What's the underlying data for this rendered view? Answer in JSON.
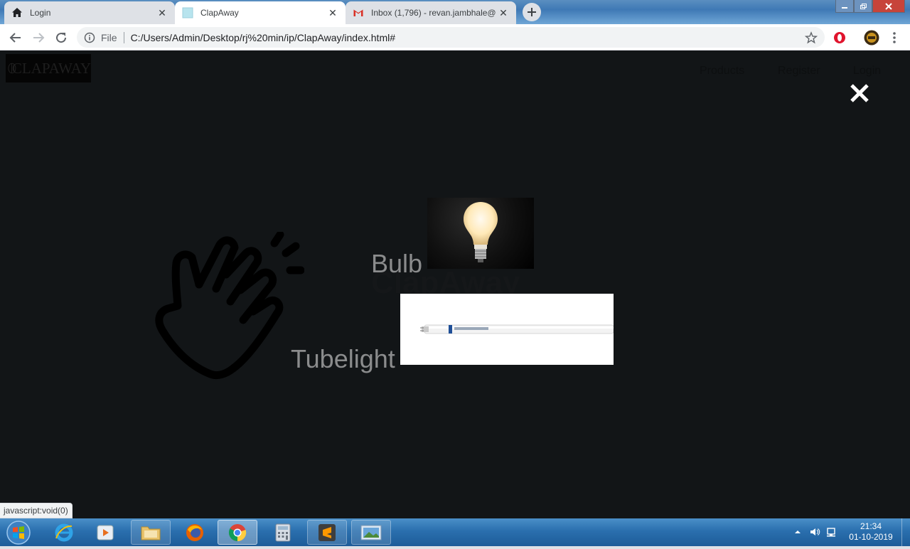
{
  "browser": {
    "tabs": [
      {
        "title": "Login",
        "icon": "home-icon",
        "active": false
      },
      {
        "title": "ClapAway",
        "icon": "page-favicon",
        "active": true
      },
      {
        "title": "Inbox (1,796) - revan.jambhale@",
        "icon": "gmail-icon",
        "active": false
      }
    ],
    "new_tab_icon": "plus-icon",
    "address": {
      "info_label": "File",
      "url": "C:/Users/Admin/Desktop/rj%20min/ip/ClapAway/index.html#"
    },
    "status_text": "javascript:void(0)"
  },
  "page": {
    "logo_text": "CLAPAWAY",
    "nav": [
      "Products",
      "Register",
      "Login"
    ],
    "heading": "ClapAway",
    "products": [
      {
        "label": "Bulb",
        "image": "bulb-image"
      },
      {
        "label": "Tubelight",
        "image": "tubelight-image"
      }
    ],
    "overlay_close_icon": "close-icon",
    "colors": {
      "page_background": "#121517",
      "overlay_text": "#8b8c8d"
    }
  },
  "taskbar": {
    "items": [
      "start-button",
      "internet-explorer",
      "media-player",
      "file-explorer",
      "firefox",
      "chrome",
      "calculator",
      "sublime-text",
      "photo-viewer"
    ],
    "active_item": "chrome",
    "clock": {
      "time": "21:34",
      "date": "01-10-2019"
    }
  }
}
